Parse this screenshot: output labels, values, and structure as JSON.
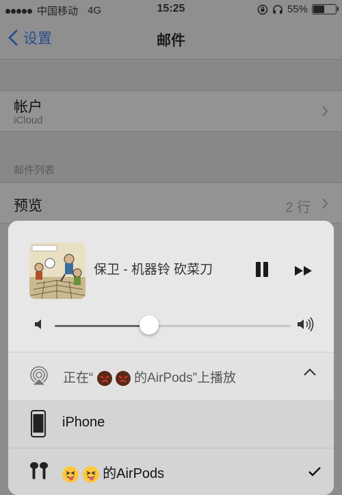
{
  "status_bar": {
    "carrier": "中国移动",
    "network": "4G",
    "time": "15:25",
    "battery": "55%",
    "battery_level": 0.55
  },
  "nav": {
    "back_label": "设置",
    "title": "邮件"
  },
  "settings": {
    "accounts": {
      "title": "帐户",
      "subtitle": "iCloud"
    },
    "mail_list_header": "邮件列表",
    "preview": {
      "title": "预览",
      "value": "2 行"
    }
  },
  "now_playing": {
    "song": "保卫 - 机器铃 砍菜刀",
    "volume_level": 0.4
  },
  "airplay": {
    "route_prefix": "正在“",
    "route_suffix": "的AirPods”上播放",
    "devices": [
      {
        "name": "iPhone"
      },
      {
        "name": "的AirPods"
      }
    ]
  },
  "colors": {
    "accent": "#2a4f8a",
    "panel_bg": "#e9e9e9"
  }
}
